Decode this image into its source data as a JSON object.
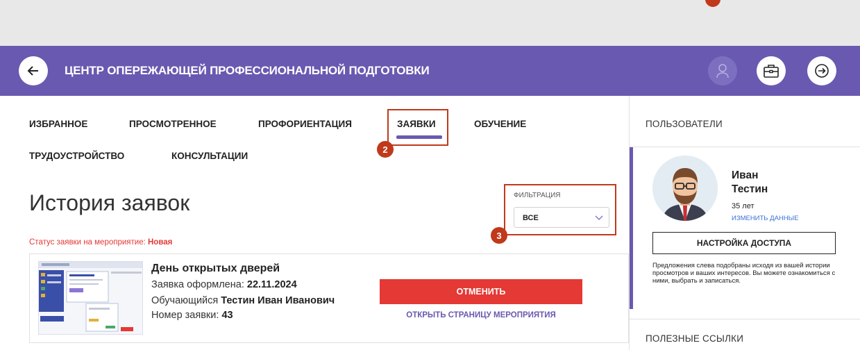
{
  "header": {
    "title": "ЦЕНТР ОПЕРЕЖАЮЩЕЙ ПРОФЕССИОНАЛЬНОЙ ПОДГОТОВКИ",
    "bg_color": "#6a59b0"
  },
  "tabs": [
    {
      "label": "ИЗБРАННОЕ"
    },
    {
      "label": "ПРОСМОТРЕННОЕ"
    },
    {
      "label": "ПРОФОРИЕНТАЦИЯ"
    },
    {
      "label": "ЗАЯВКИ",
      "active": true
    },
    {
      "label": "ОБУЧЕНИЕ"
    },
    {
      "label": "ТРУДОУСТРОЙСТВО"
    },
    {
      "label": "КОНСУЛЬТАЦИИ"
    }
  ],
  "annotations": {
    "badge_2": "2",
    "badge_3": "3"
  },
  "page": {
    "title": "История заявок",
    "filter_label": "ФИЛЬТРАЦИЯ",
    "filter_value": "ВСЕ",
    "status_prefix": "Статус заявки на мероприятие: ",
    "status_value": "Новая"
  },
  "card": {
    "title": "День открытых дверей",
    "date_label": "Заявка оформлена: ",
    "date_value": "22.11.2024",
    "student_label": "Обучающийся ",
    "student_value": "Тестин Иван Иванович",
    "number_label": "Номер заявки: ",
    "number_value": "43",
    "cancel_label": "ОТМЕНИТЬ",
    "open_label": "ОТКРЫТЬ СТРАНИЦУ МЕРОПРИЯТИЯ"
  },
  "sidebar": {
    "users_heading": "ПОЛЬЗОВАТЕЛИ",
    "first_name": "Иван",
    "last_name": "Тестин",
    "age": "35 лет",
    "edit_label": "ИЗМЕНИТЬ ДАННЫЕ",
    "access_label": "НАСТРОЙКА ДОСТУПА",
    "access_note": "Предложения слева подобраны исходя из вашей истории просмотров и ваших интересов. Вы можете ознакомиться с ними, выбрать и записаться.",
    "links_heading": "ПОЛЕЗНЫЕ ССЫЛКИ"
  },
  "colors": {
    "accent": "#6a59b0",
    "danger": "#e53935",
    "marker": "#c0391b",
    "link": "#3a6fd8"
  }
}
